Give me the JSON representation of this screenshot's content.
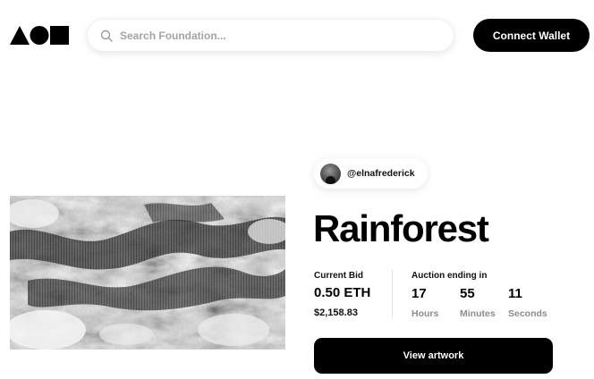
{
  "header": {
    "logo_icon": "foundation-logo-icon",
    "search": {
      "placeholder": "Search Foundation...",
      "icon": "search-icon"
    },
    "connect_label": "Connect Wallet"
  },
  "artwork": {
    "icon": "rainforest-artwork-image",
    "creator": "@elnafrederick",
    "title": "Rainforest"
  },
  "bid": {
    "label": "Current Bid",
    "eth": "0.50 ETH",
    "usd": "$2,158.83"
  },
  "auction": {
    "label": "Auction ending in",
    "countdown": [
      {
        "value": "17",
        "unit": "Hours"
      },
      {
        "value": "55",
        "unit": "Minutes"
      },
      {
        "value": "11",
        "unit": "Seconds"
      }
    ]
  },
  "cta": {
    "view_label": "View artwork"
  },
  "colors": {
    "primary": "#000000",
    "background": "#ffffff",
    "muted": "#8c8c8c"
  }
}
